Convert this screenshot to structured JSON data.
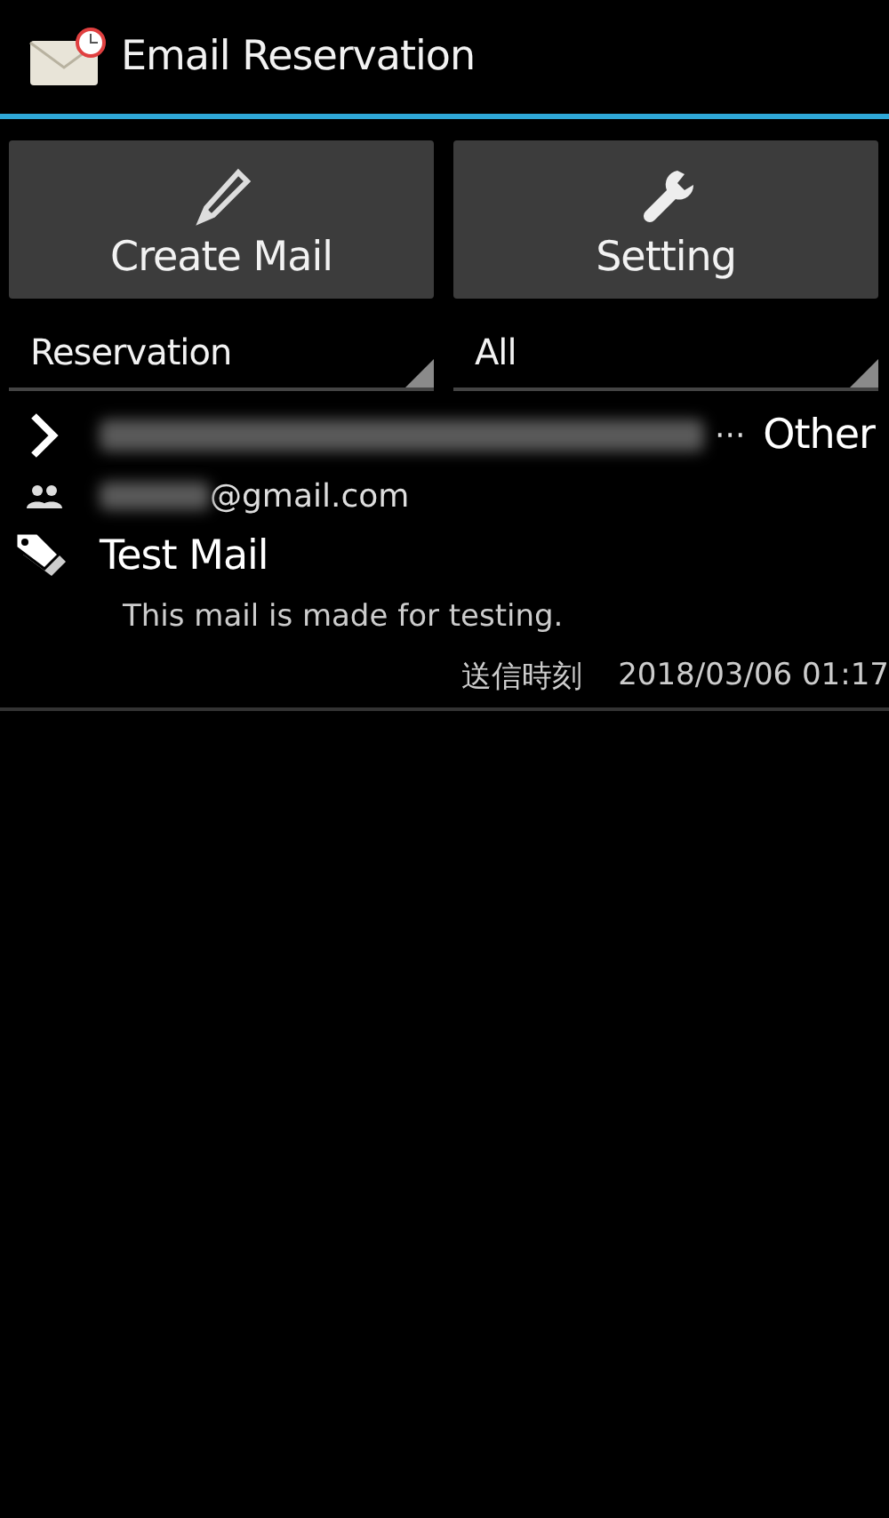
{
  "app_bar": {
    "title": "Email Reservation"
  },
  "buttons": [
    {
      "kind": "pencil",
      "label": "Create Mail"
    },
    {
      "kind": "wrench",
      "label": "Setting"
    }
  ],
  "filters": [
    {
      "value": "Reservation"
    },
    {
      "value": "All"
    }
  ],
  "mails": [
    {
      "recipient_suffix": "···",
      "category": "Other",
      "sender_domain": "@gmail.com",
      "subject": "Test Mail",
      "body": "This mail is made for testing.",
      "time_label": "送信時刻",
      "time": "2018/03/06 01:17"
    }
  ]
}
